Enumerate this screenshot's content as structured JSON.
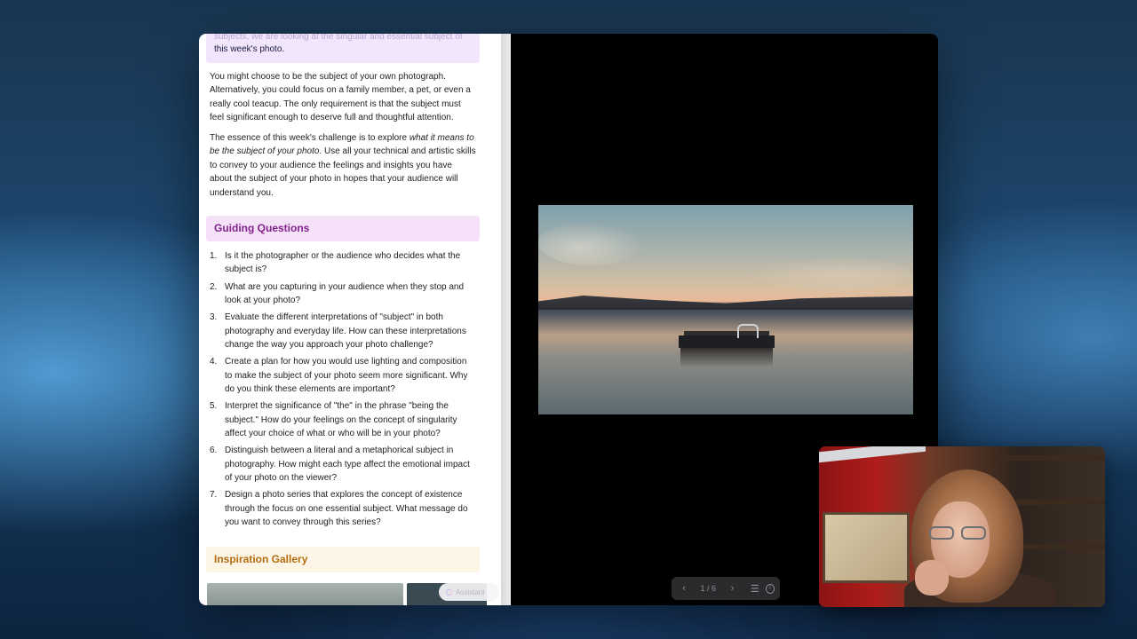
{
  "document": {
    "top_callout": {
      "faded_text": "subjects, we are looking at the singular and essential subject of",
      "line2": "this week's photo."
    },
    "paragraph1": "You might choose to be the subject of your own photograph. Alternatively, you could focus on a family member, a pet, or even a really cool teacup. The only requirement is that the subject must feel significant enough to deserve full and thoughtful attention.",
    "paragraph2": {
      "before": "The essence of this week's challenge is to explore ",
      "italic": "what it means to be the subject of your photo",
      "after": ". Use all your technical and artistic skills to convey to your audience the feelings and insights you have about the subject of your photo in hopes that your audience will understand you."
    },
    "guiding_heading": "Guiding Questions",
    "questions": [
      {
        "num": "1.",
        "text": "Is it the photographer or the audience who decides what the subject is?"
      },
      {
        "num": "2.",
        "text": "What are you capturing in your audience when they stop and look at your photo?"
      },
      {
        "num": "3.",
        "text": "Evaluate the different interpretations of \"subject\" in both photography and everyday life. How can these interpretations change the way you approach your photo challenge?"
      },
      {
        "num": "4.",
        "text": "Create a plan for how you would use lighting and composition to make the subject of your photo seem more significant. Why do you think these elements are important?"
      },
      {
        "num": "5.",
        "text": "Interpret the significance of \"the\" in the phrase \"being the subject.\" How do your feelings on the concept of singularity affect your choice of what or who will be in your photo?"
      },
      {
        "num": "6.",
        "text": "Distinguish between a literal and a metaphorical subject in photography. How might each type affect the emotional impact of your photo on the viewer?"
      },
      {
        "num": "7.",
        "text": "Design a photo series that explores the concept of existence through the focus on one essential subject. What message do you want to convey through this series?"
      }
    ],
    "gallery_heading": "Inspiration Gallery",
    "assistant_label": "Assistant"
  },
  "viewer": {
    "page_indicator": "1 / 6",
    "prev_icon": "chevron-left-icon",
    "next_icon": "chevron-right-icon",
    "list_icon": "list-icon",
    "info_icon": "info-icon"
  },
  "colors": {
    "guiding_heading": "#82228c",
    "gallery_heading": "#b36c10",
    "guiding_bg": "#f5e2f9",
    "gallery_bg": "#fdf5e6"
  }
}
